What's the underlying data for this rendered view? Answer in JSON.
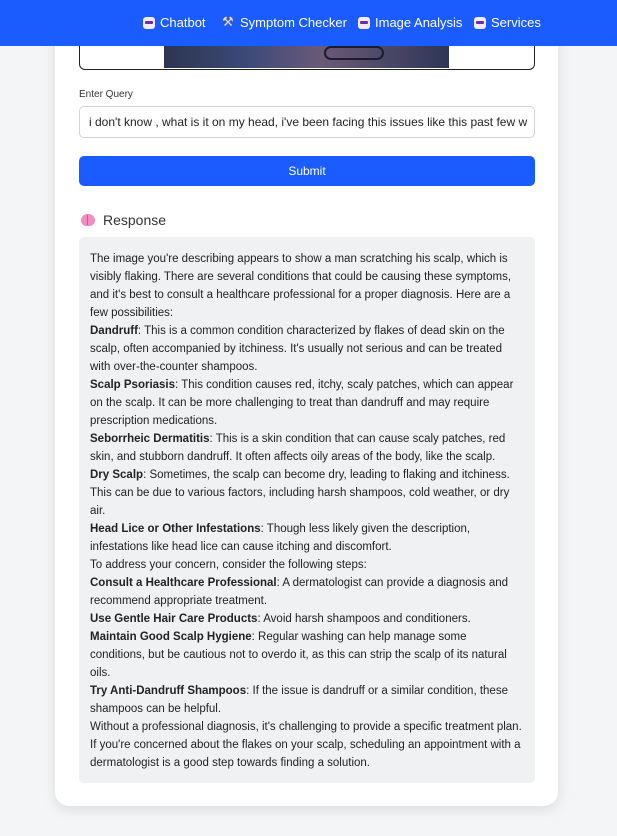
{
  "navbar": {
    "items": [
      {
        "label": "Chatbot",
        "icon": "robot-icon"
      },
      {
        "label": "Symptom Checker",
        "icon": "tools-icon"
      },
      {
        "label": "Image Analysis",
        "icon": "robot-icon"
      },
      {
        "label": "Services",
        "icon": "robot-icon"
      }
    ],
    "color": "#1a5cff"
  },
  "form": {
    "query_label": "Enter Query",
    "query_value": "i don't know , what is it on my head, i've been facing this issues like this past few w",
    "submit_label": "Submit"
  },
  "response": {
    "heading": "Response",
    "heading_icon": "brain-icon",
    "intro": "The image you're describing appears to show a man scratching his scalp, which is visibly flaking. There are several conditions that could be causing these symptoms, and it's best to consult a healthcare professional for a proper diagnosis. Here are a few possibilities:",
    "conditions": [
      {
        "term": "Dandruff",
        "text": ": This is a common condition characterized by flakes of dead skin on the scalp, often accompanied by itchiness. It's usually not serious and can be treated with over-the-counter shampoos."
      },
      {
        "term": "Scalp Psoriasis",
        "text": ": This condition causes red, itchy, scaly patches, which can appear on the scalp. It can be more challenging to treat than dandruff and may require prescription medications."
      },
      {
        "term": "Seborrheic Dermatitis",
        "text": ": This is a skin condition that can cause scaly patches, red skin, and stubborn dandruff. It often affects oily areas of the body, like the scalp."
      },
      {
        "term": "Dry Scalp",
        "text": ": Sometimes, the scalp can become dry, leading to flaking and itchiness. This can be due to various factors, including harsh shampoos, cold weather, or dry air."
      },
      {
        "term": "Head Lice or Other Infestations",
        "text": ": Though less likely given the description, infestations like head lice can cause itching and discomfort."
      }
    ],
    "steps_intro": "To address your concern, consider the following steps:",
    "steps": [
      {
        "term": "Consult a Healthcare Professional",
        "text": ": A dermatologist can provide a diagnosis and recommend appropriate treatment."
      },
      {
        "term": "Use Gentle Hair Care Products",
        "text": ": Avoid harsh shampoos and conditioners."
      },
      {
        "term": "Maintain Good Scalp Hygiene",
        "text": ": Regular washing can help manage some conditions, but be cautious not to overdo it, as this can strip the scalp of its natural oils."
      },
      {
        "term": "Try Anti-Dandruff Shampoos",
        "text": ": If the issue is dandruff or a similar condition, these shampoos can be helpful."
      }
    ],
    "closing": "Without a professional diagnosis, it's challenging to provide a specific treatment plan. If you're concerned about the flakes on your scalp, scheduling an appointment with a dermatologist is a good step towards finding a solution."
  }
}
